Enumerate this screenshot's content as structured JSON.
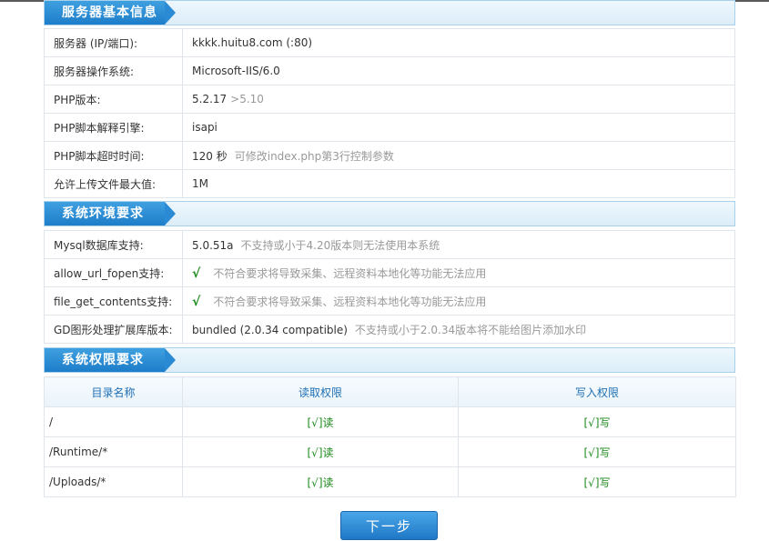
{
  "sections": {
    "server": "服务器基本信息",
    "env": "系统环境要求",
    "perm": "系统权限要求"
  },
  "server_info": [
    {
      "label": "服务器 (IP/端口):",
      "value": "kkkk.huitu8.com (:80)",
      "note": ""
    },
    {
      "label": "服务器操作系统:",
      "value": "Microsoft-IIS/6.0",
      "note": ""
    },
    {
      "label": "PHP版本:",
      "value": "5.2.17",
      "note": ">5.10"
    },
    {
      "label": "PHP脚本解释引擎:",
      "value": "isapi",
      "note": ""
    },
    {
      "label": "PHP脚本超时时间:",
      "value": "120 秒",
      "note": "可修改index.php第3行控制参数"
    },
    {
      "label": "允许上传文件最大值:",
      "value": "1M",
      "note": ""
    }
  ],
  "env_info": [
    {
      "label": "Mysql数据库支持:",
      "value": "5.0.51a",
      "note": "不支持或小于4.20版本则无法使用本系统"
    },
    {
      "label": "allow_url_fopen支持:",
      "value": "√",
      "note": "不符合要求将导致采集、远程资料本地化等功能无法应用"
    },
    {
      "label": "file_get_contents支持:",
      "value": "√",
      "note": "不符合要求将导致采集、远程资料本地化等功能无法应用"
    },
    {
      "label": "GD图形处理扩展库版本:",
      "value": "bundled (2.0.34 compatible)",
      "note": "不支持或小于2.0.34版本将不能给图片添加水印"
    }
  ],
  "perm_table": {
    "headers": [
      "目录名称",
      "读取权限",
      "写入权限"
    ],
    "rows": [
      {
        "path": "/",
        "read": "[√]读",
        "write": "[√]写"
      },
      {
        "path": "/Runtime/*",
        "read": "[√]读",
        "write": "[√]写"
      },
      {
        "path": "/Uploads/*",
        "read": "[√]读",
        "write": "[√]写"
      }
    ]
  },
  "next_button": "下一步",
  "colors": {
    "accent": "#1d7dc9",
    "ok": "#1b8a1b",
    "note": "#999999"
  }
}
